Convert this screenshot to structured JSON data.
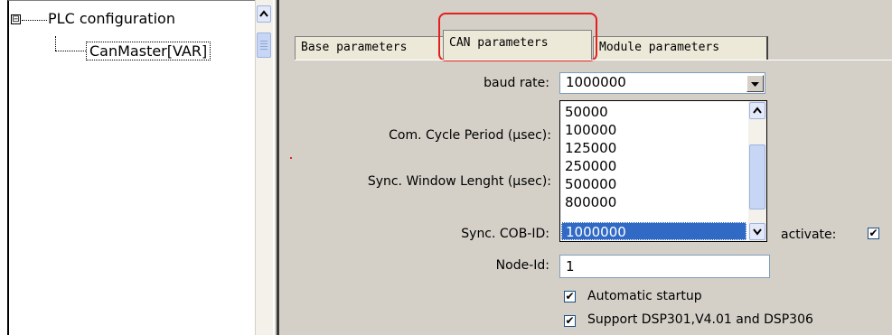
{
  "tree": {
    "root_label": "PLC configuration",
    "child_label": "CanMaster[VAR]",
    "expander": "⊟"
  },
  "tabs": [
    {
      "label": "Base parameters"
    },
    {
      "label": "CAN parameters"
    },
    {
      "label": "Module parameters"
    }
  ],
  "form": {
    "baud_rate_label": "baud rate:",
    "baud_rate_value": "1000000",
    "com_cycle_label": "Com. Cycle Period (µsec):",
    "sync_window_label": "Sync. Window Lenght (µsec):",
    "sync_cob_label": "Sync. COB-ID:",
    "activate_label": "activate:",
    "activate_checked": "✔",
    "node_id_label": "Node-Id:",
    "node_id_value": "1",
    "auto_startup_label": "Automatic startup",
    "auto_startup_checked": "✔",
    "support_dsp_label": "Support DSP301,V4.01 and DSP306",
    "support_dsp_checked": "✔"
  },
  "baud_options": [
    "50000",
    "100000",
    "125000",
    "250000",
    "500000",
    "800000",
    "1000000"
  ],
  "selected_option": "1000000",
  "colors": {
    "selection": "#316ac5",
    "highlight_box": "#e41f1f",
    "panel_bg": "#d4d0c8"
  }
}
